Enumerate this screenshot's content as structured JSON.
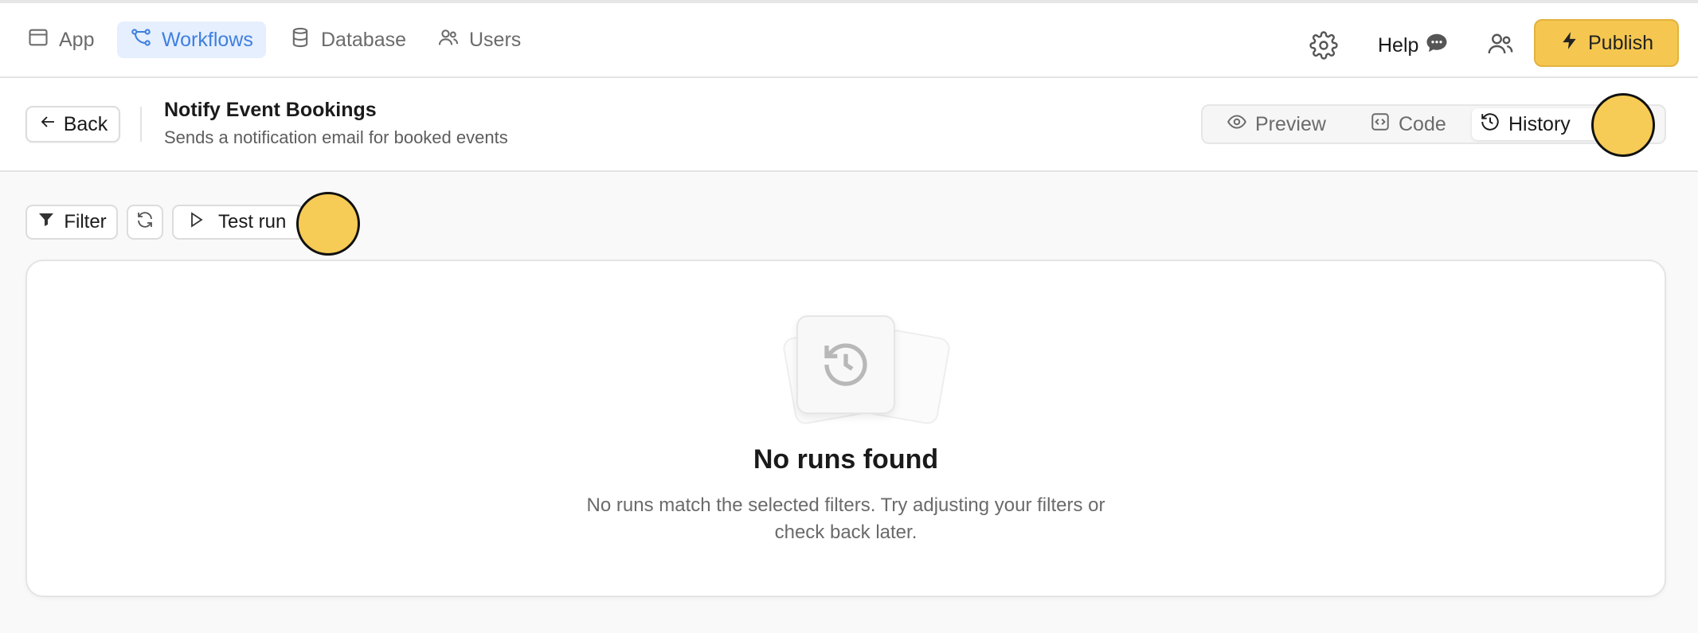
{
  "nav": {
    "items": [
      {
        "label": "App",
        "icon": "window-icon"
      },
      {
        "label": "Workflows",
        "icon": "workflow-icon",
        "active": true
      },
      {
        "label": "Database",
        "icon": "database-icon"
      },
      {
        "label": "Users",
        "icon": "users-icon"
      }
    ],
    "help_label": "Help",
    "publish_label": "Publish"
  },
  "header": {
    "back_label": "Back",
    "title": "Notify Event Bookings",
    "description": "Sends a notification email for booked events",
    "tabs": [
      {
        "label": "Preview",
        "icon": "eye-icon"
      },
      {
        "label": "Code",
        "icon": "code-icon"
      },
      {
        "label": "History",
        "icon": "history-icon",
        "active": true
      }
    ]
  },
  "toolbar": {
    "filter_label": "Filter",
    "test_run_label": "Test run"
  },
  "empty_state": {
    "title": "No runs found",
    "description": "No runs match the selected filters. Try adjusting your filters or check back later."
  },
  "colors": {
    "accent": "#3f7fe0",
    "active_bg": "#e5effd",
    "publish": "#f5c750",
    "highlight": "#f6cb56"
  }
}
